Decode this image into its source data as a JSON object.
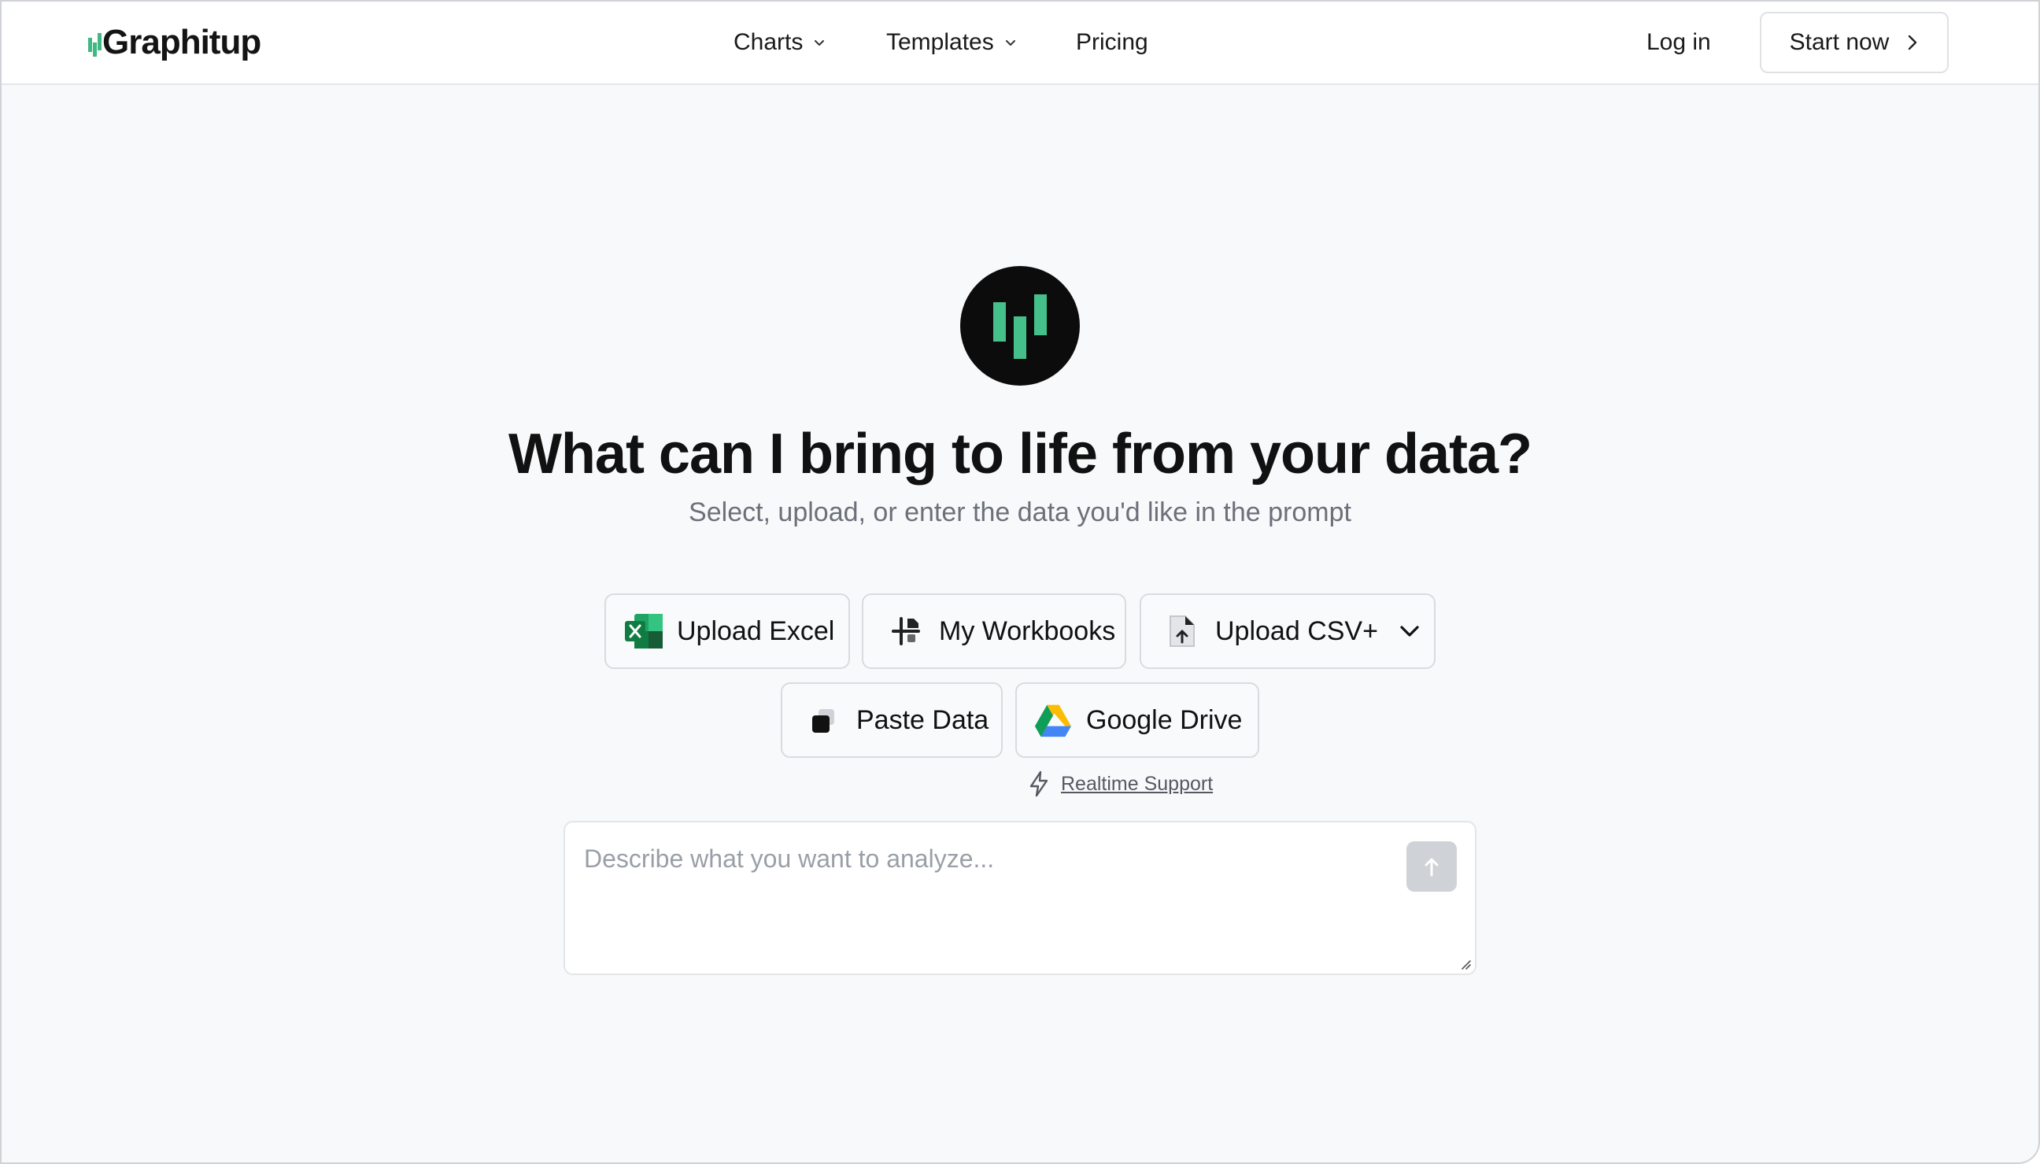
{
  "brand": {
    "name": "Graphitup",
    "accent_color": "#3fb883",
    "icon": "bar-chart-logo-icon"
  },
  "nav": {
    "items": [
      {
        "label": "Charts",
        "has_dropdown": true
      },
      {
        "label": "Templates",
        "has_dropdown": true
      },
      {
        "label": "Pricing",
        "has_dropdown": false
      }
    ],
    "login_label": "Log in",
    "start_label": "Start now"
  },
  "hero": {
    "title": "What can I bring to life from your data?",
    "subtitle": "Select, upload, or enter the data you'd like in the prompt"
  },
  "actions": {
    "upload_excel": "Upload Excel",
    "my_workbooks": "My Workbooks",
    "upload_csv": "Upload CSV+",
    "paste_data": "Paste Data",
    "google_drive": "Google Drive"
  },
  "support": {
    "label": "Realtime Support",
    "icon": "lightning-icon"
  },
  "prompt": {
    "placeholder": "Describe what you want to analyze...",
    "value": ""
  }
}
